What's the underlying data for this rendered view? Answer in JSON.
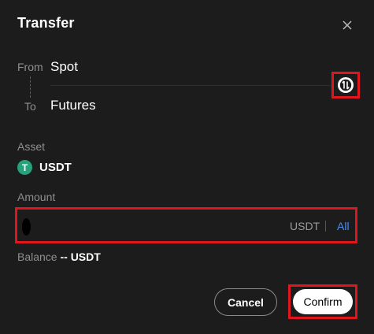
{
  "dialog": {
    "title": "Transfer",
    "close_icon": "close-icon"
  },
  "accounts": {
    "from_label": "From",
    "from_value": "Spot",
    "to_label": "To",
    "to_value": "Futures",
    "swap_icon": "swap-arrows-icon"
  },
  "asset": {
    "label": "Asset",
    "symbol_glyph": "T",
    "name": "USDT",
    "icon": "usdt-token-icon",
    "icon_color": "#26a17b"
  },
  "amount": {
    "label": "Amount",
    "value": "",
    "placeholder": "",
    "unit": "USDT",
    "all_label": "All",
    "all_color": "#4a8cff"
  },
  "balance": {
    "label": "Balance",
    "value": "-- USDT"
  },
  "actions": {
    "cancel_label": "Cancel",
    "confirm_label": "Confirm"
  },
  "colors": {
    "background": "#1c1c1c",
    "highlight": "#e0161f"
  }
}
